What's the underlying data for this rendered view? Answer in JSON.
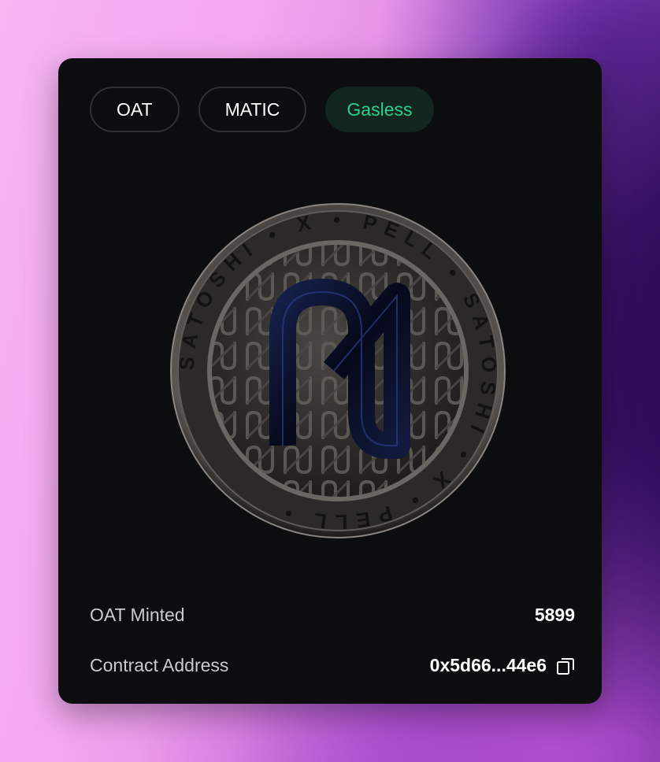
{
  "tags": [
    {
      "label": "OAT"
    },
    {
      "label": "MATIC"
    },
    {
      "label": "Gasless"
    }
  ],
  "coin": {
    "ring_text": "SATOSHI • X • PELL • SATOSHI • X • PELL •"
  },
  "stats": {
    "minted_label": "OAT Minted",
    "minted_value": "5899",
    "contract_label": "Contract Address",
    "contract_value": "0x5d66...44e6"
  },
  "icons": {
    "copy": "copy-icon"
  },
  "colors": {
    "card": "#0c0d0f",
    "gasless_text": "#2fcf8e",
    "gasless_bg": "#12261f",
    "logo": "#0a0f22"
  }
}
